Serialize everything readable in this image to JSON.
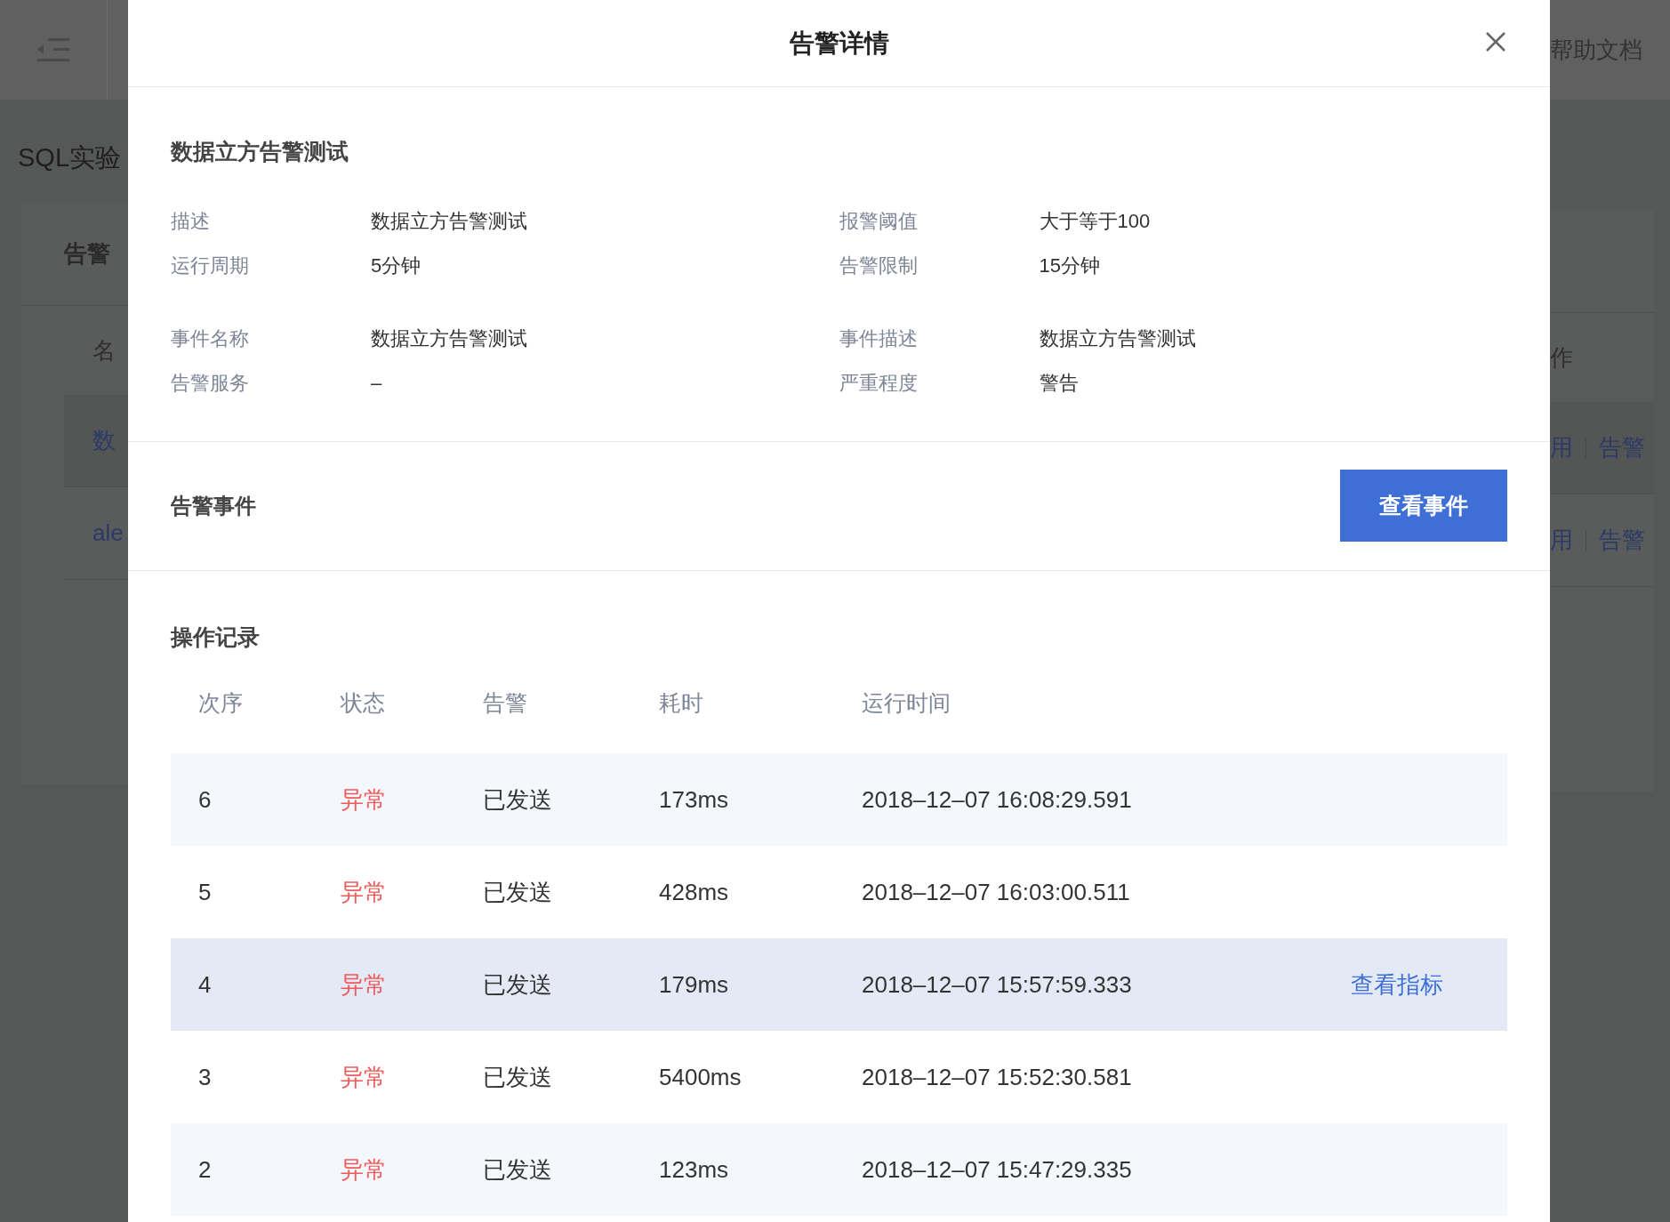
{
  "background": {
    "top_bar": {
      "help_link": "帮助文档"
    },
    "page_title": "SQL实验",
    "card_tab": "告警",
    "column_1": "名",
    "column_right": "作",
    "rows": [
      {
        "name": "数",
        "action_1": "用",
        "action_2": "告警"
      },
      {
        "name": "ale",
        "action_1": "用",
        "action_2": "告警"
      }
    ]
  },
  "dialog": {
    "title": "告警详情",
    "rule": {
      "title": "数据立方告警测试",
      "fields": [
        {
          "label": "描述",
          "value": "数据立方告警测试"
        },
        {
          "label": "报警阈值",
          "value": "大于等于100"
        },
        {
          "label": "运行周期",
          "value": "5分钟"
        },
        {
          "label": "告警限制",
          "value": "15分钟"
        }
      ],
      "event_fields": [
        {
          "label": "事件名称",
          "value": "数据立方告警测试"
        },
        {
          "label": "事件描述",
          "value": "数据立方告警测试"
        },
        {
          "label": "告警服务",
          "value": "–"
        },
        {
          "label": "严重程度",
          "value": "警告"
        }
      ]
    },
    "events": {
      "title": "告警事件",
      "button": "查看事件"
    },
    "log": {
      "title": "操作记录",
      "columns": [
        "次序",
        "状态",
        "告警",
        "耗时",
        "运行时间"
      ],
      "rows": [
        {
          "seq": "6",
          "status": "异常",
          "abnormal": true,
          "alert": "已发送",
          "duration": "173ms",
          "time": "2018–12–07 16:08:29.591",
          "selected": false
        },
        {
          "seq": "5",
          "status": "异常",
          "abnormal": true,
          "alert": "已发送",
          "duration": "428ms",
          "time": "2018–12–07 16:03:00.511",
          "selected": false
        },
        {
          "seq": "4",
          "status": "异常",
          "abnormal": true,
          "alert": "已发送",
          "duration": "179ms",
          "time": "2018–12–07 15:57:59.333",
          "selected": true,
          "action": "查看指标"
        },
        {
          "seq": "3",
          "status": "异常",
          "abnormal": true,
          "alert": "已发送",
          "duration": "5400ms",
          "time": "2018–12–07 15:52:30.581",
          "selected": false
        },
        {
          "seq": "2",
          "status": "异常",
          "abnormal": true,
          "alert": "已发送",
          "duration": "123ms",
          "time": "2018–12–07 15:47:29.335",
          "selected": false
        }
      ]
    }
  }
}
